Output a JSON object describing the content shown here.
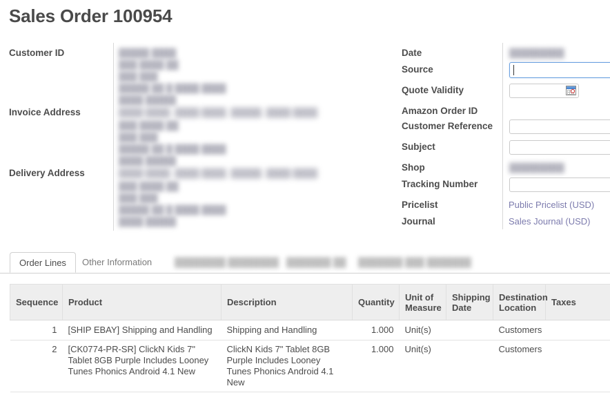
{
  "header": {
    "title": "Sales Order 100954"
  },
  "form": {
    "left_fields": [
      {
        "label": "Customer ID",
        "redacted": true
      },
      {
        "label": "Invoice Address",
        "redacted": true
      },
      {
        "label": "Delivery Address",
        "redacted": true
      }
    ],
    "customer_id_lines": [
      "█████ ████",
      "███ ████ ██",
      "███ ███",
      "█████ ██ █ ████ ████",
      "████ █████"
    ],
    "invoice_address_lines": [
      "████ ████,  ████ ████,  █████,  ████ ████",
      "███ ████ ██",
      "███ ███",
      "█████ ██ █ ████ ████",
      "████ █████"
    ],
    "delivery_address_lines": [
      "████ ████,  ████ ████,  █████,  ████ ████",
      "███ ████ ██",
      "███ ███",
      "█████ ██ █ ████ ████",
      "████ █████"
    ],
    "right": {
      "date_label": "Date",
      "date_value_redacted": "█████████",
      "source_label": "Source",
      "source_value": "",
      "quote_validity_label": "Quote Validity",
      "quote_validity_value": "",
      "amazon_order_id_label": "Amazon Order ID",
      "amazon_order_id_value": "",
      "customer_reference_label": "Customer Reference",
      "customer_reference_value": "",
      "subject_label": "Subject",
      "subject_value": "",
      "shop_label": "Shop",
      "shop_value_redacted": "█████████",
      "tracking_number_label": "Tracking Number",
      "tracking_number_value": "",
      "pricelist_label": "Pricelist",
      "pricelist_value": "Public Pricelist (USD)",
      "journal_label": "Journal",
      "journal_value": "Sales Journal (USD)"
    }
  },
  "tabs": [
    {
      "label": "Order Lines",
      "active": true,
      "blurred": false
    },
    {
      "label": "Other Information",
      "active": false,
      "blurred": false
    },
    {
      "label": "████████ ████████",
      "active": false,
      "blurred": true
    },
    {
      "label": "███████ ██",
      "active": false,
      "blurred": true
    },
    {
      "label": "███████ ███ ███████",
      "active": false,
      "blurred": true
    }
  ],
  "order_lines": {
    "columns": [
      "Sequence",
      "Product",
      "Description",
      "Quantity",
      "Unit of Measure",
      "Shipping Date",
      "Destination Location",
      "Taxes"
    ],
    "rows": [
      {
        "sequence": "1",
        "product": "[SHIP EBAY] Shipping and Handling",
        "description": "Shipping and Handling",
        "quantity": "1.000",
        "unit_of_measure": "Unit(s)",
        "shipping_date": "",
        "destination_location": "Customers",
        "taxes": ""
      },
      {
        "sequence": "2",
        "product": "[CK0774-PR-SR] ClickN Kids 7\" Tablet 8GB Purple Includes Looney Tunes Phonics Android 4.1 New",
        "description": "ClickN Kids 7\" Tablet 8GB Purple Includes Looney Tunes Phonics Android 4.1 New",
        "quantity": "1.000",
        "unit_of_measure": "Unit(s)",
        "shipping_date": "",
        "destination_location": "Customers",
        "taxes": ""
      }
    ]
  },
  "colors": {
    "link": "#7c7bad",
    "text": "#4c4c4c",
    "header_bg": "#eeeeee",
    "focus_border": "#6aa0e0"
  }
}
